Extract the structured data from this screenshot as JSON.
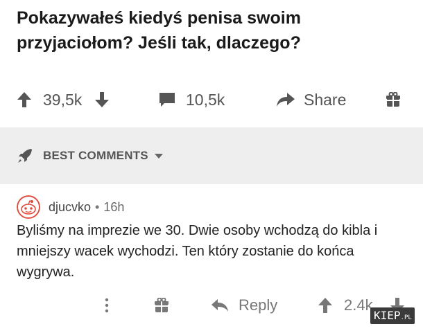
{
  "post": {
    "title": "Pokazywałeś kiedyś penisa swoim przyjaciołom? Jeśli tak, dlaczego?"
  },
  "actions": {
    "votes": "39,5k",
    "comments": "10,5k",
    "share_label": "Share"
  },
  "sort": {
    "label": "BEST COMMENTS"
  },
  "comment": {
    "username": "djucvko",
    "separator": "•",
    "time": "16h",
    "body": "Byliśmy na imprezie we 30. Dwie osoby wchodzą do kibla i mniejszy wacek wychodzi. Ten który zostanie do końca wygrywa.",
    "reply_label": "Reply",
    "votes": "2.4k"
  },
  "watermark": {
    "text": "KIEP",
    "suffix": ".PL"
  },
  "colors": {
    "text": "#1a1a1a",
    "muted": "#555555",
    "band": "#eeeeee",
    "accent": "#ff4500"
  }
}
